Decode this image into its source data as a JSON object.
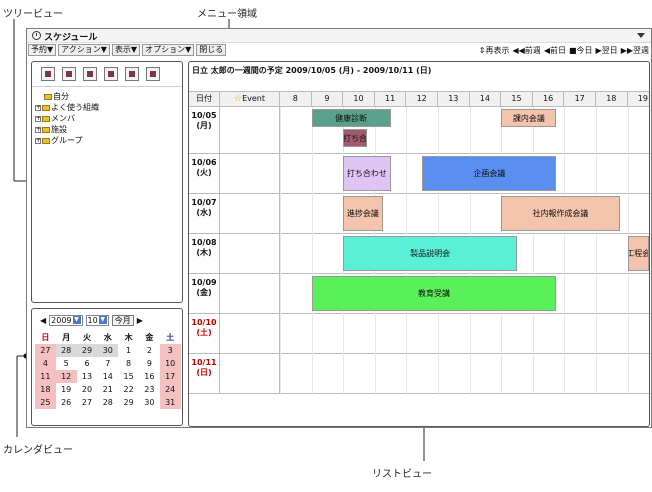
{
  "annotations": {
    "tree_view": "ツリービュー",
    "menu_area": "メニュー領域",
    "calendar_view": "カレンダビュー",
    "list_view": "リストビュー"
  },
  "window": {
    "title": "スケジュール",
    "menus": [
      "予約▼",
      "アクション▼",
      "表示▼",
      "オプション▼",
      "閉じる"
    ],
    "nav": [
      "⇕再表示",
      "◀◀前週",
      "◀前日",
      "■今日",
      "▶翌日",
      "▶▶翌週"
    ]
  },
  "tree": {
    "toolbar_icons": [
      "new-icon",
      "week-icon",
      "month-icon",
      "list-icon",
      "edit-icon",
      "export-icon"
    ],
    "items": [
      "自分",
      "よく使う組織",
      "メンバ",
      "施設",
      "グループ"
    ]
  },
  "calendar": {
    "year": "2009",
    "month": "10",
    "today_label": "今月",
    "day_names": [
      "日",
      "月",
      "火",
      "水",
      "木",
      "金",
      "土"
    ],
    "weeks": [
      [
        "27",
        "28",
        "29",
        "30",
        "1",
        "2",
        "3"
      ],
      [
        "4",
        "5",
        "6",
        "7",
        "8",
        "9",
        "10"
      ],
      [
        "11",
        "12",
        "13",
        "14",
        "15",
        "16",
        "17"
      ],
      [
        "18",
        "19",
        "20",
        "21",
        "22",
        "23",
        "24"
      ],
      [
        "25",
        "26",
        "27",
        "28",
        "29",
        "30",
        "31"
      ]
    ]
  },
  "schedule": {
    "title": "日立 太郎の一週間の予定 2009/10/05 (月) - 2009/10/11 (日)",
    "date_header": "日付",
    "event_header": "Event",
    "hours": [
      "8",
      "9",
      "10",
      "11",
      "12",
      "13",
      "14",
      "15",
      "16",
      "17",
      "18",
      "19"
    ],
    "days": [
      {
        "date": "10/05",
        "dow": "(月)"
      },
      {
        "date": "10/06",
        "dow": "(火)"
      },
      {
        "date": "10/07",
        "dow": "(水)"
      },
      {
        "date": "10/08",
        "dow": "(木)"
      },
      {
        "date": "10/09",
        "dow": "(金)"
      },
      {
        "date": "10/10",
        "dow": "(土)"
      },
      {
        "date": "10/11",
        "dow": "(日)"
      }
    ],
    "events": [
      {
        "day": 0,
        "lane": 0,
        "start": 9.0,
        "end": 11.5,
        "label": "健康診断",
        "color": "#5aa08a"
      },
      {
        "day": 0,
        "lane": 1,
        "start": 10.0,
        "end": 10.75,
        "label": "打ち合",
        "color": "#a05a6e"
      },
      {
        "day": 0,
        "lane": 0,
        "start": 15.0,
        "end": 16.75,
        "label": "課内会議",
        "color": "#f4c4ac"
      },
      {
        "day": 1,
        "lane": 0,
        "start": 10.0,
        "end": 11.5,
        "label": "打ち合わせ",
        "color": "#e0c4f4"
      },
      {
        "day": 1,
        "lane": 0,
        "start": 12.5,
        "end": 16.75,
        "label": "企画会議",
        "color": "#5a8ef0"
      },
      {
        "day": 2,
        "lane": 0,
        "start": 10.0,
        "end": 11.25,
        "label": "進捗会議",
        "color": "#f4c4ac"
      },
      {
        "day": 2,
        "lane": 0,
        "start": 15.0,
        "end": 18.75,
        "label": "社内報作成会議",
        "color": "#f4c4ac"
      },
      {
        "day": 3,
        "lane": 0,
        "start": 10.0,
        "end": 15.5,
        "label": "製品説明会",
        "color": "#5af0d8"
      },
      {
        "day": 3,
        "lane": 0,
        "start": 19.0,
        "end": 20.0,
        "label": "工程会",
        "color": "#f4c4ac"
      },
      {
        "day": 4,
        "lane": 0,
        "start": 9.0,
        "end": 16.75,
        "label": "教育受講",
        "color": "#5af05a"
      }
    ]
  }
}
